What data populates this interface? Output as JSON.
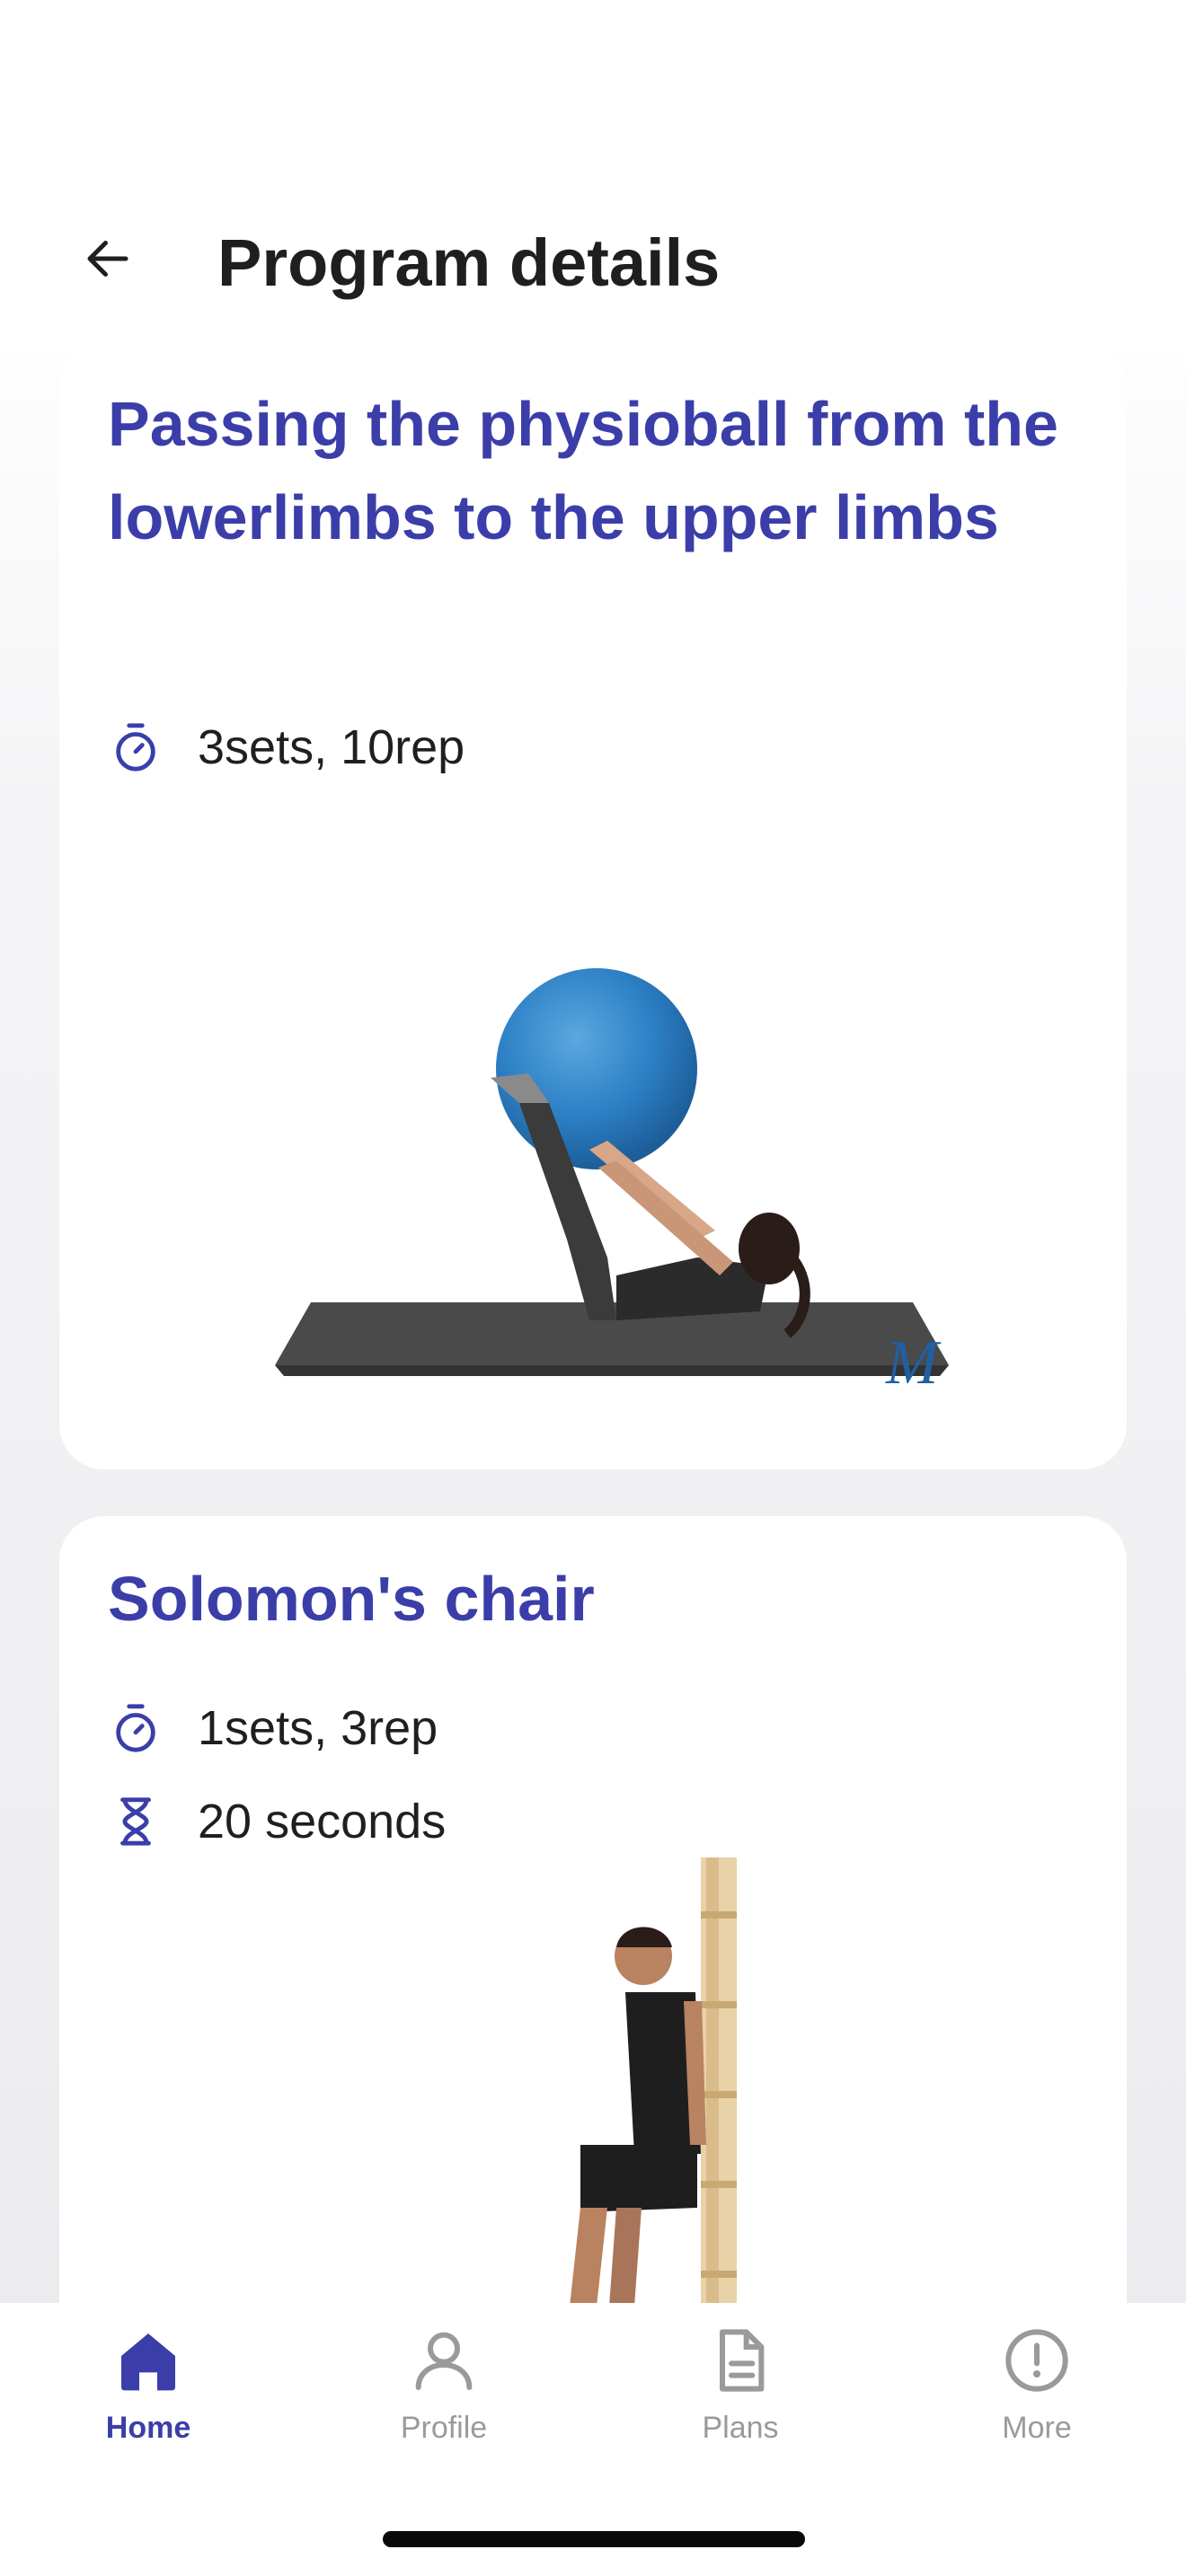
{
  "header": {
    "title": "Program details",
    "back_icon": "arrow-left-icon"
  },
  "exercises": [
    {
      "title": "Passing the physioball from the lowerlimbs to the upper limbs",
      "sets_reps": "3sets, 10rep",
      "illustration": "woman-on-mat-with-blue-ball"
    },
    {
      "title": "Solomon's chair",
      "sets_reps": "1sets, 3rep",
      "duration": "20 seconds",
      "illustration": "man-wall-sit"
    }
  ],
  "nav": {
    "items": [
      {
        "label": "Home",
        "icon": "home-icon",
        "active": true
      },
      {
        "label": "Profile",
        "icon": "person-icon",
        "active": false
      },
      {
        "label": "Plans",
        "icon": "document-icon",
        "active": false
      },
      {
        "label": "More",
        "icon": "more-icon",
        "active": false
      }
    ]
  },
  "colors": {
    "accent": "#3b3ea9",
    "inactive": "#9a9a9a",
    "text": "#1f1f1f"
  }
}
